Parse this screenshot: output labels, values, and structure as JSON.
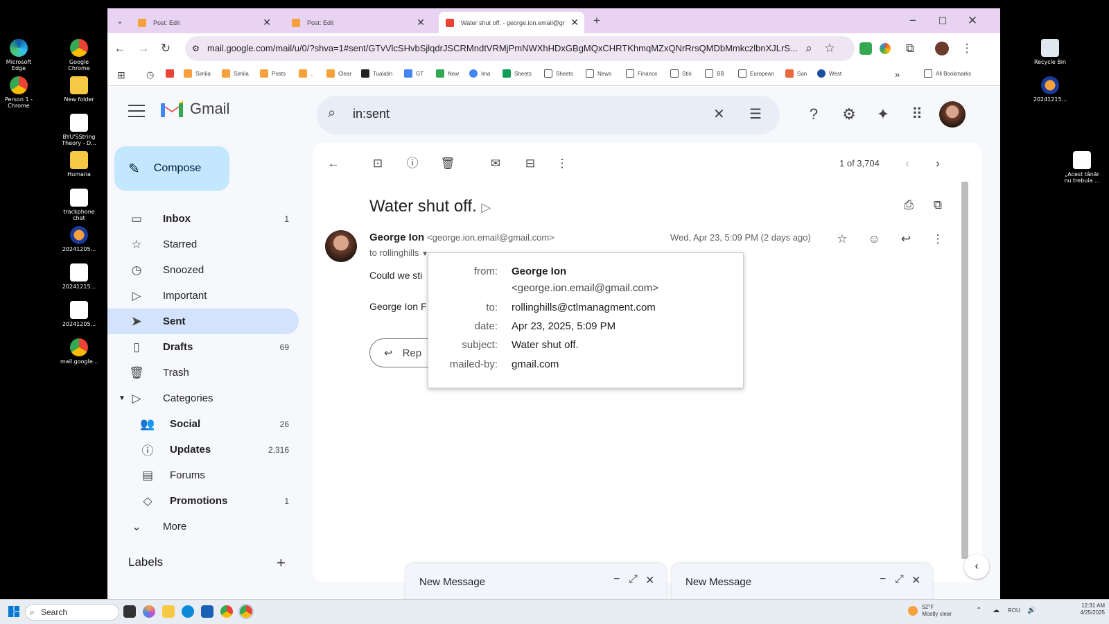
{
  "desktop": {
    "left_icons": [
      {
        "label": "Microsoft Edge"
      },
      {
        "label": "Google Chrome"
      },
      {
        "label": "Person 1 - Chrome"
      },
      {
        "label": "New folder"
      },
      {
        "label": "BYU'SString Theory - D..."
      },
      {
        "label": "Humana"
      },
      {
        "label": "trackphone chat"
      },
      {
        "label": "20241205..."
      },
      {
        "label": "20241215..."
      },
      {
        "label": "20241205..."
      },
      {
        "label": "mail.google..."
      }
    ],
    "right_icons": [
      {
        "label": "Recycle Bin"
      },
      {
        "label": "20241215..."
      },
      {
        "label": "„Acest tânăr nu trebuia ..."
      }
    ]
  },
  "browser": {
    "tabs": [
      {
        "title": "Post: Edit",
        "color": "#f6a13c"
      },
      {
        "title": "Post: Edit",
        "color": "#f6a13c"
      },
      {
        "title": "Water shut off. - george.ion.email@gmail.com",
        "color": "#ea4335"
      }
    ],
    "url": "mail.google.com/mail/u/0/?shva=1#sent/GTvVlcSHvbSjlqdrJSCRMndtVRMjPmNWXhHDxGBgMQxCHRTKhmqMZxQNrRrsQMDbMmkczlbnXJLrS...",
    "bookmarks": [
      {
        "label": "Simila",
        "color": "#f6a13c"
      },
      {
        "label": "Simila",
        "color": "#f6a13c"
      },
      {
        "label": "Posts",
        "color": "#f6a13c"
      },
      {
        "label": "..",
        "color": "#f6a13c"
      },
      {
        "label": "Clear",
        "color": "#f6a13c"
      },
      {
        "label": "Tualatin",
        "color": "#222"
      },
      {
        "label": "GT",
        "color": "#4285f4"
      },
      {
        "label": "New",
        "color": "#34a853"
      },
      {
        "label": "Ima",
        "color": "#4285f4"
      },
      {
        "label": "Sheets",
        "color": "#0f9d58"
      },
      {
        "label": "Sheets",
        "color": "#fff"
      },
      {
        "label": "News",
        "color": "#fff"
      },
      {
        "label": "Finance",
        "color": "#fff"
      },
      {
        "label": "Stiri",
        "color": "#fff"
      },
      {
        "label": "BB",
        "color": "#fff"
      },
      {
        "label": "European",
        "color": "#fff"
      },
      {
        "label": "San",
        "color": "#e8693e"
      },
      {
        "label": "West",
        "color": "#1a4fa0"
      }
    ],
    "all_bookmarks": "All Bookmarks"
  },
  "gmail": {
    "logo_text": "Gmail",
    "search_query": "in:sent",
    "compose_label": "Compose",
    "nav": [
      {
        "label": "Inbox",
        "count": "1",
        "icon": "inbox-icon",
        "glyph": "▭"
      },
      {
        "label": "Starred",
        "count": "",
        "icon": "star-icon",
        "glyph": "☆"
      },
      {
        "label": "Snoozed",
        "count": "",
        "icon": "clock-icon",
        "glyph": "◷"
      },
      {
        "label": "Important",
        "count": "",
        "icon": "important-icon",
        "glyph": "▷"
      },
      {
        "label": "Sent",
        "count": "",
        "icon": "send-icon",
        "glyph": "➤"
      },
      {
        "label": "Drafts",
        "count": "69",
        "icon": "draft-icon",
        "glyph": "▯"
      },
      {
        "label": "Trash",
        "count": "",
        "icon": "trash-icon",
        "glyph": "🗑"
      },
      {
        "label": "Categories",
        "count": "",
        "icon": "label-icon",
        "glyph": "▷"
      },
      {
        "label": "Social",
        "count": "26",
        "icon": "people-icon",
        "glyph": "👥"
      },
      {
        "label": "Updates",
        "count": "2,316",
        "icon": "info-icon",
        "glyph": "ⓘ"
      },
      {
        "label": "Forums",
        "count": "",
        "icon": "forum-icon",
        "glyph": "▤"
      },
      {
        "label": "Promotions",
        "count": "1",
        "icon": "tag-icon",
        "glyph": "◇"
      },
      {
        "label": "More",
        "count": "",
        "icon": "chevron-down-icon",
        "glyph": "⌄"
      }
    ],
    "labels_heading": "Labels",
    "pager": "1 of 3,704",
    "subject": "Water shut off.",
    "sender_name": "George Ion",
    "sender_email": "<george.ion.email@gmail.com>",
    "to_line": "to rollinghills",
    "date": "Wed, Apr 23, 5:09 PM (2 days ago)",
    "body_line1": "Could we sti",
    "body_line2": "George Ion F",
    "reply_label": "Rep",
    "details": {
      "from_label": "from:",
      "from_name": "George Ion",
      "from_email": "<george.ion.email@gmail.com>",
      "to_label": "to:",
      "to_value": "rollinghills@ctlmanagment.com",
      "date_label": "date:",
      "date_value": "Apr 23, 2025, 5:09 PM",
      "subject_label": "subject:",
      "subject_value": "Water shut off.",
      "mailedby_label": "mailed-by:",
      "mailedby_value": "gmail.com"
    },
    "new_message_windows": [
      "New Message",
      "New Message"
    ]
  },
  "taskbar": {
    "search_placeholder": "Search",
    "weather_temp": "52°F",
    "weather_desc": "Mostly clear",
    "lang": "ROU",
    "time": "12:31 AM",
    "date": "4/25/2025"
  }
}
